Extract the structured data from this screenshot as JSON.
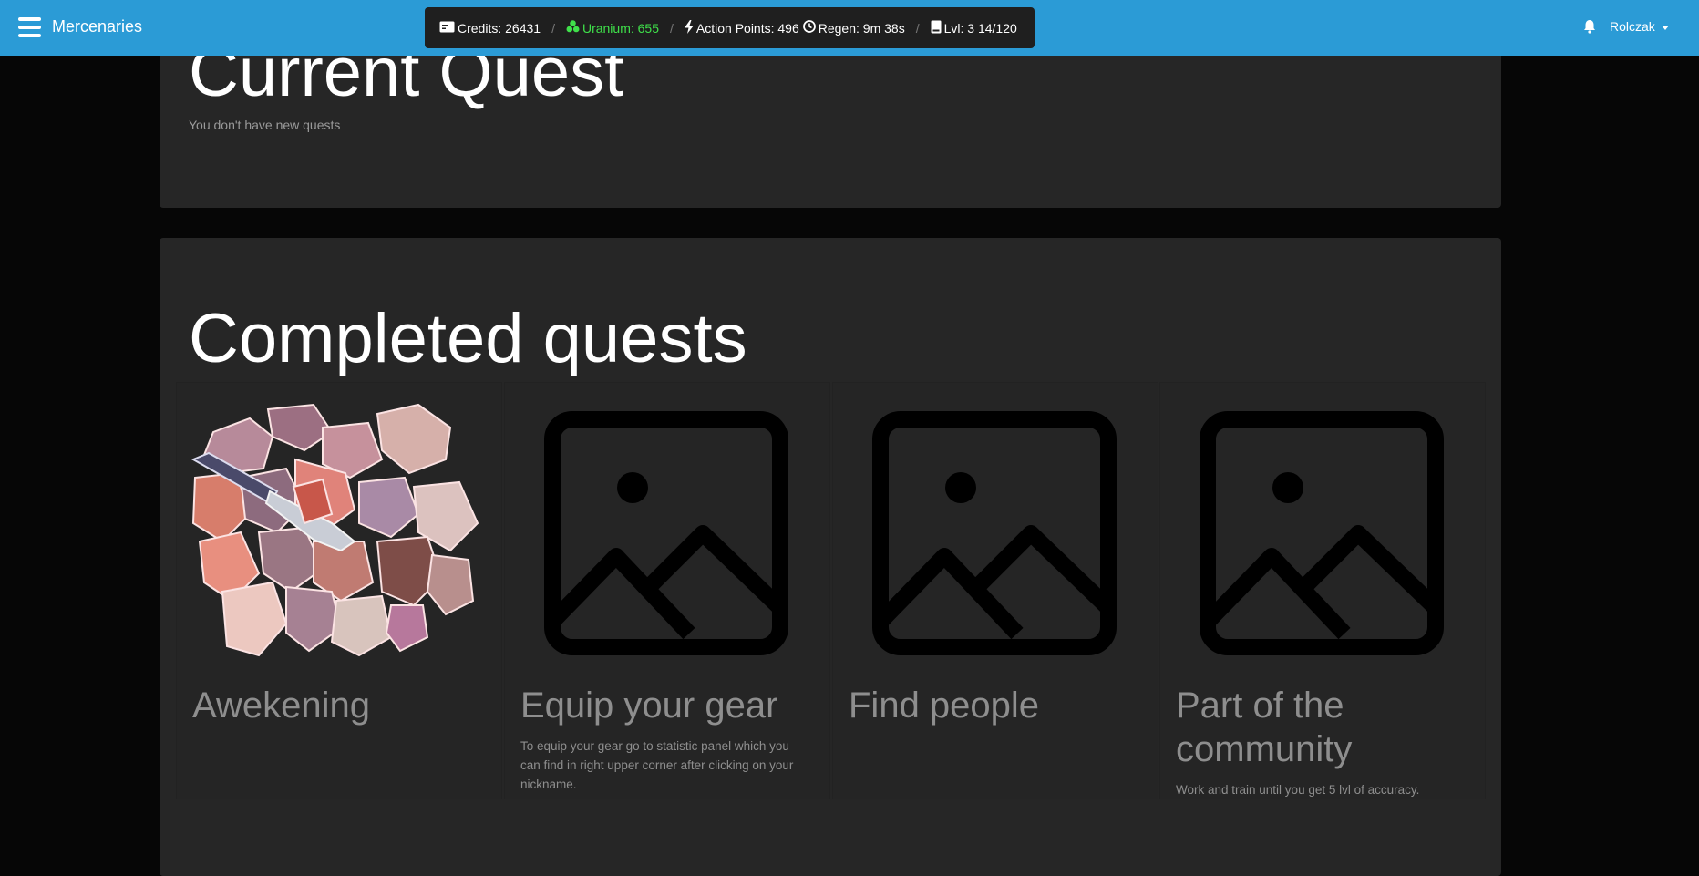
{
  "navbar": {
    "brand": "Mercenaries",
    "user_name": "Rolczak",
    "accent_color": "#2b9bd6"
  },
  "status": {
    "credits": "Credits: 26431",
    "uranium": "Uranium: 655",
    "action_points": "Action Points: 496",
    "regen": "Regen: 9m 38s",
    "level": "Lvl: 3 14/120",
    "separator": "/"
  },
  "current_quest": {
    "title": "Current Quest",
    "empty_text": "You don't have new quests"
  },
  "completed_quests": {
    "title": "Completed quests",
    "items": [
      {
        "title": "Awekening",
        "description": "",
        "image": "rocks-and-knife"
      },
      {
        "title": "Equip your gear",
        "description": "To equip your gear go to statistic panel which you can find in right upper corner after clicking on your nickname.",
        "image": "image-placeholder-icon"
      },
      {
        "title": "Find people",
        "description": "",
        "image": "image-placeholder-icon"
      },
      {
        "title": "Part of the community",
        "description": "Work and train until you get 5 lvl of accuracy.",
        "image": "image-placeholder-icon"
      }
    ]
  }
}
